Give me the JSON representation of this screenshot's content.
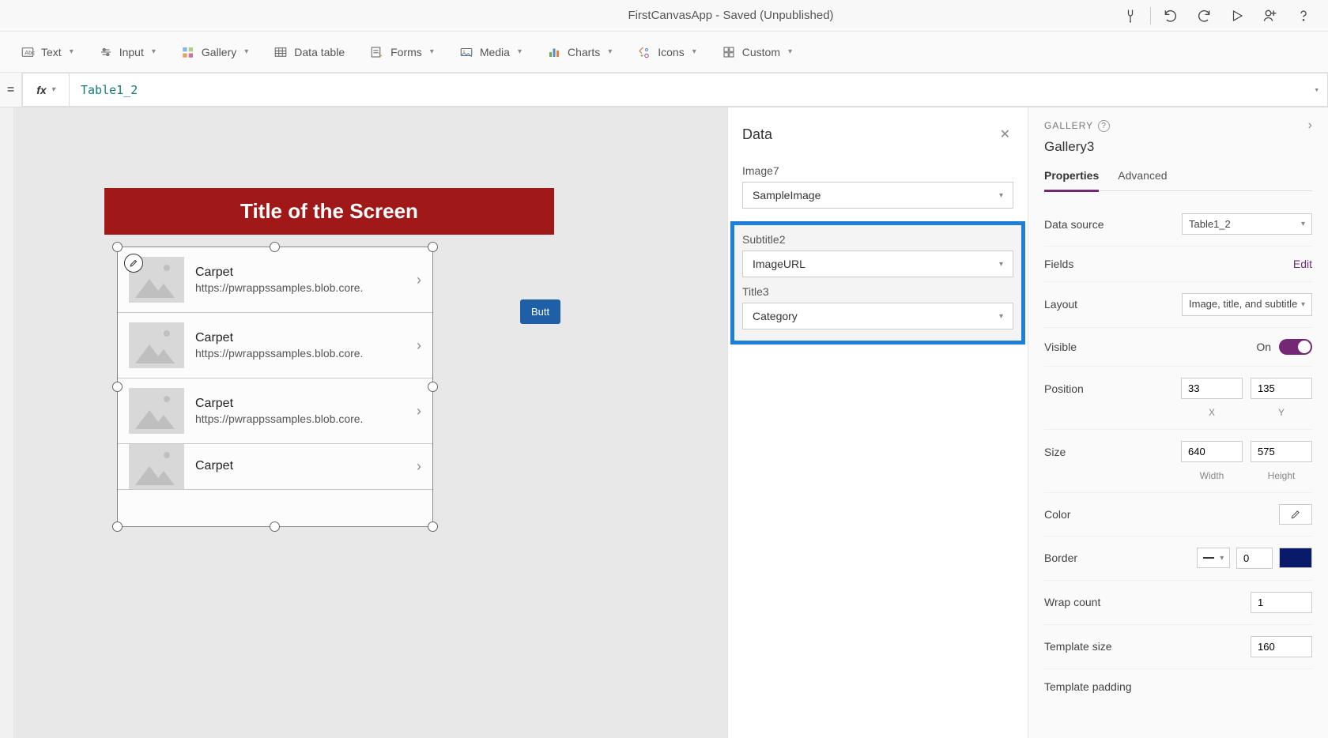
{
  "titlebar": {
    "app_title": "FirstCanvasApp - Saved (Unpublished)"
  },
  "ribbon": {
    "text": "Text",
    "input": "Input",
    "gallery": "Gallery",
    "data_table": "Data table",
    "forms": "Forms",
    "media": "Media",
    "charts": "Charts",
    "icons": "Icons",
    "custom": "Custom"
  },
  "formula": {
    "equals": "=",
    "fx": "fx",
    "value": "Table1_2"
  },
  "canvas": {
    "screen_title": "Title of the Screen",
    "button_label": "Butt",
    "gallery_items": [
      {
        "title": "Carpet",
        "subtitle": "https://pwrappssamples.blob.core."
      },
      {
        "title": "Carpet",
        "subtitle": "https://pwrappssamples.blob.core."
      },
      {
        "title": "Carpet",
        "subtitle": "https://pwrappssamples.blob.core."
      },
      {
        "title": "Carpet",
        "subtitle": ""
      }
    ]
  },
  "data_panel": {
    "title": "Data",
    "fields": {
      "image_label": "Image7",
      "image_value": "SampleImage",
      "subtitle_label": "Subtitle2",
      "subtitle_value": "ImageURL",
      "title_label": "Title3",
      "title_value": "Category"
    }
  },
  "props": {
    "category": "GALLERY",
    "control_name": "Gallery3",
    "tabs": {
      "properties": "Properties",
      "advanced": "Advanced"
    },
    "data_source_label": "Data source",
    "data_source_value": "Table1_2",
    "fields_label": "Fields",
    "fields_action": "Edit",
    "layout_label": "Layout",
    "layout_value": "Image, title, and subtitle",
    "visible_label": "Visible",
    "visible_state": "On",
    "position_label": "Position",
    "position_x": "33",
    "position_y": "135",
    "x_label": "X",
    "y_label": "Y",
    "size_label": "Size",
    "size_w": "640",
    "size_h": "575",
    "w_label": "Width",
    "h_label": "Height",
    "color_label": "Color",
    "border_label": "Border",
    "border_value": "0",
    "wrap_label": "Wrap count",
    "wrap_value": "1",
    "tsize_label": "Template size",
    "tsize_value": "160",
    "tpad_label": "Template padding"
  }
}
